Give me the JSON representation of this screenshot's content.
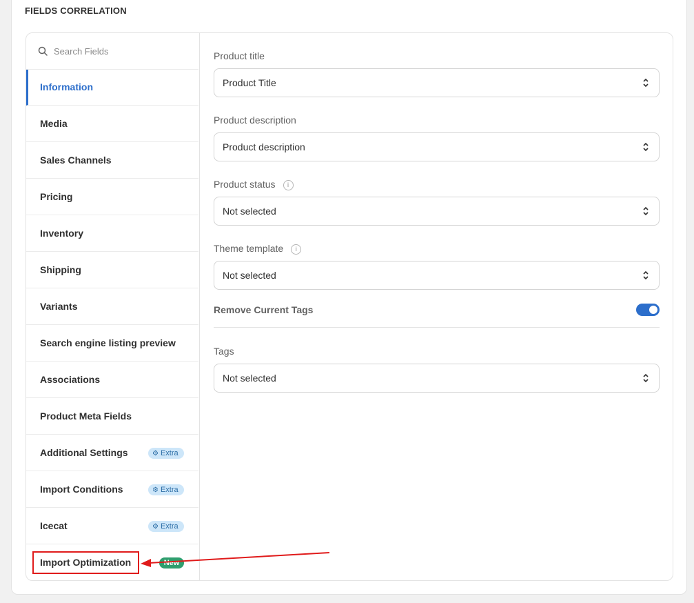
{
  "section": {
    "title": "FIELDS CORRELATION"
  },
  "sidebar": {
    "search_placeholder": "Search Fields",
    "items": [
      {
        "label": "Information",
        "active": true
      },
      {
        "label": "Media"
      },
      {
        "label": "Sales Channels"
      },
      {
        "label": "Pricing"
      },
      {
        "label": "Inventory"
      },
      {
        "label": "Shipping"
      },
      {
        "label": "Variants"
      },
      {
        "label": "Search engine listing preview"
      },
      {
        "label": "Associations"
      },
      {
        "label": "Product Meta Fields"
      },
      {
        "label": "Additional Settings",
        "badge": "Extra"
      },
      {
        "label": "Import Conditions",
        "badge": "Extra"
      },
      {
        "label": "Icecat",
        "badge": "Extra"
      },
      {
        "label": "Import Optimization",
        "badge": "New"
      }
    ]
  },
  "form": {
    "product_title": {
      "label": "Product title",
      "value": "Product Title"
    },
    "product_description": {
      "label": "Product description",
      "value": "Product description"
    },
    "product_status": {
      "label": "Product status",
      "value": "Not selected"
    },
    "theme_template": {
      "label": "Theme template",
      "value": "Not selected"
    },
    "remove_tags": {
      "label": "Remove Current Tags",
      "enabled": true
    },
    "tags": {
      "label": "Tags",
      "value": "Not selected"
    }
  },
  "colors": {
    "accent": "#2c6ecb",
    "extra_badge_bg": "#cde6f9",
    "new_badge_bg": "#2f9e6e",
    "annotation": "#e01b1b"
  },
  "icons": [
    "search-icon",
    "info-icon",
    "select-chevron-icon",
    "gear-icon",
    "annotation-arrow-icon"
  ]
}
